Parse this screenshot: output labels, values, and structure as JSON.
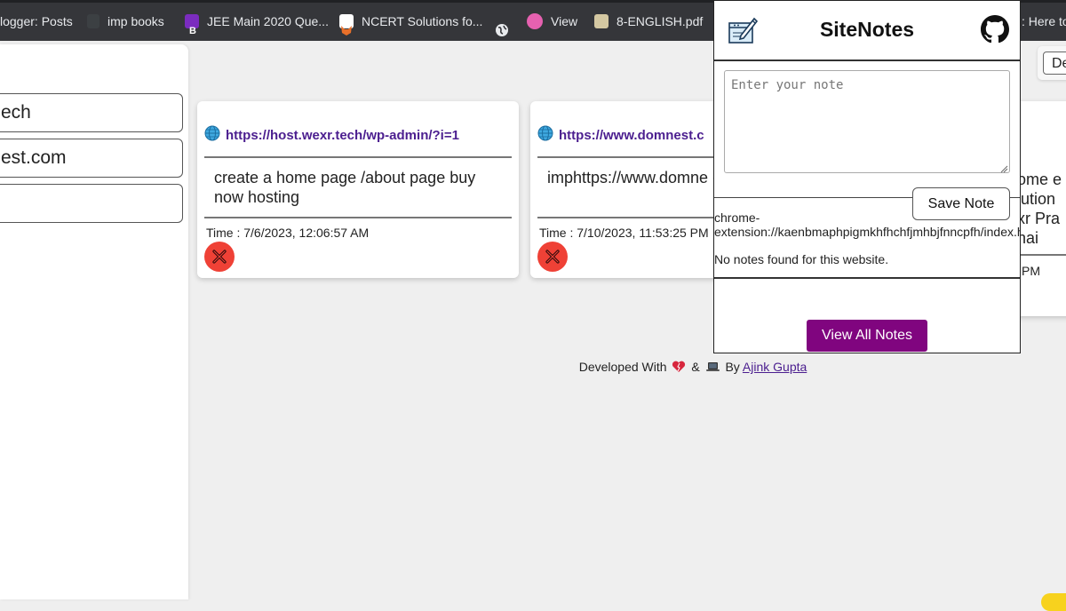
{
  "bookmarks": [
    {
      "label": "logger: Posts",
      "icon": "blogger-icon",
      "color": "#35363a"
    },
    {
      "label": "imp books",
      "icon": "folder-icon",
      "color": "#3c4043"
    },
    {
      "label": "JEE Main 2020 Que...",
      "icon": "b-logo-icon",
      "color": "#7b2cbf"
    },
    {
      "label": "NCERT Solutions fo...",
      "icon": "fox-icon",
      "color": "#e8702a"
    },
    {
      "label": "",
      "icon": "globe-icon",
      "color": "#e8eaed"
    },
    {
      "label": "View",
      "icon": "pink-circle-icon",
      "color": "#e661b0"
    },
    {
      "label": "8-ENGLISH.pdf",
      "icon": "pdf-icon",
      "color": "#d4c8a2"
    },
    {
      "label": ": Here to",
      "icon": "",
      "color": ""
    }
  ],
  "sidebar": {
    "items": [
      {
        "label": "ech"
      },
      {
        "label": "est.com"
      },
      {
        "label": ""
      }
    ]
  },
  "cards": [
    {
      "url": "https://host.wexr.tech/wp-admin/?i=1",
      "note": "create a home page /about page buy now hosting",
      "time": "Time : 7/6/2023, 12:06:57 AM"
    },
    {
      "url": "https://www.domnest.c",
      "note": "imphttps://www.domne domains",
      "time": "Time : 7/10/2023, 11:53:25 PM"
    }
  ],
  "card3": {
    "lines": [
      "ome e",
      "lution",
      "xr Pra",
      "hai"
    ],
    "time": "PM"
  },
  "corner_button": {
    "label": "De"
  },
  "footer": {
    "prefix": "Developed With",
    "amp": "&",
    "by": "By",
    "author": "Ajink Gupta"
  },
  "popup": {
    "title": "SiteNotes",
    "note_placeholder": "Enter your note",
    "save_label": "Save Note",
    "current_url": "chrome-extension://kaenbmaphpigmkhfhchfjmhbjfnncpfh/index.html",
    "current_url_line1": "chrome-",
    "current_url_line2": "extension://kaenbmaphpigmkhfhchfjmhbjfnncpfh/index.ht",
    "no_notes": "No notes found for this website.",
    "view_all_label": "View All Notes"
  },
  "colors": {
    "accent_purple": "#80057f",
    "link_purple": "#4b1e8f",
    "delete_red": "#ef4136",
    "bookmarks_bar": "#35363a"
  }
}
